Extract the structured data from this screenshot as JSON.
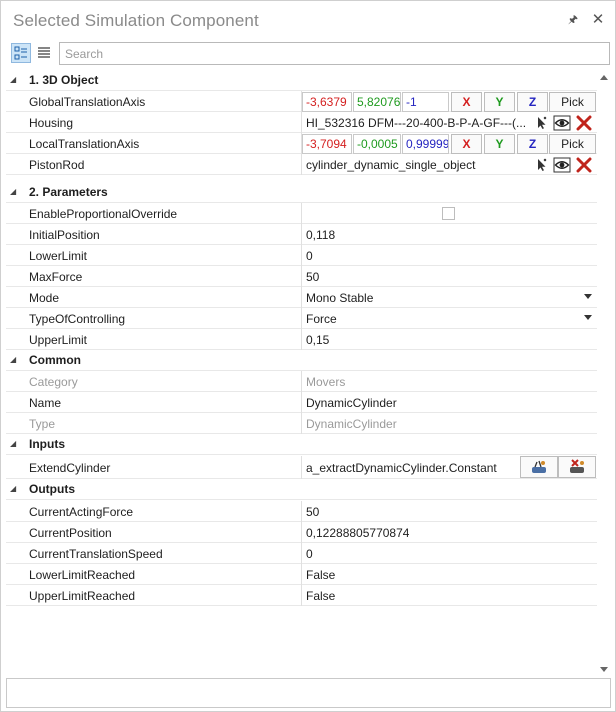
{
  "window": {
    "title": "Selected Simulation Component",
    "pin_icon": "pin-icon",
    "close_icon": "close-icon"
  },
  "toolbar": {
    "search_placeholder": "Search"
  },
  "categories": {
    "object3d": "1. 3D Object",
    "parameters": "2. Parameters",
    "common": "Common",
    "inputs": "Inputs",
    "outputs": "Outputs"
  },
  "object3d": {
    "global": {
      "name": "GlobalTranslationAxis",
      "x": "-3,6379",
      "y": "5,82076",
      "z": "-1"
    },
    "housing": {
      "name": "Housing",
      "value": "HI_532316 DFM---20-400-B-P-A-GF---(..."
    },
    "local": {
      "name": "LocalTranslationAxis",
      "x": "-3,7094",
      "y": "-0,0005",
      "z": "0,99999"
    },
    "pistonrod": {
      "name": "PistonRod",
      "value": "cylinder_dynamic_single_object"
    },
    "axis_labels": {
      "x": "X",
      "y": "Y",
      "z": "Z",
      "pick": "Pick"
    }
  },
  "parameters": [
    {
      "name": "EnableProportionalOverride",
      "value": ""
    },
    {
      "name": "InitialPosition",
      "value": "0,118"
    },
    {
      "name": "LowerLimit",
      "value": "0"
    },
    {
      "name": "MaxForce",
      "value": "50"
    },
    {
      "name": "Mode",
      "value": "Mono Stable"
    },
    {
      "name": "TypeOfControlling",
      "value": "Force"
    },
    {
      "name": "UpperLimit",
      "value": "0,15"
    }
  ],
  "common": [
    {
      "name": "Category",
      "value": "Movers"
    },
    {
      "name": "Name",
      "value": "DynamicCylinder"
    },
    {
      "name": "Type",
      "value": "DynamicCylinder"
    }
  ],
  "inputs": [
    {
      "name": "ExtendCylinder",
      "value": "a_extractDynamicCylinder.Constant"
    }
  ],
  "outputs": [
    {
      "name": "CurrentActingForce",
      "value": "50"
    },
    {
      "name": "CurrentPosition",
      "value": "0,12288805770874"
    },
    {
      "name": "CurrentTranslationSpeed",
      "value": "0"
    },
    {
      "name": "LowerLimitReached",
      "value": "False"
    },
    {
      "name": "UpperLimitReached",
      "value": "False"
    }
  ],
  "colors": {
    "x": "#d42020",
    "y": "#1f9a1f",
    "z": "#2424c0",
    "delete": "#c0241c"
  }
}
